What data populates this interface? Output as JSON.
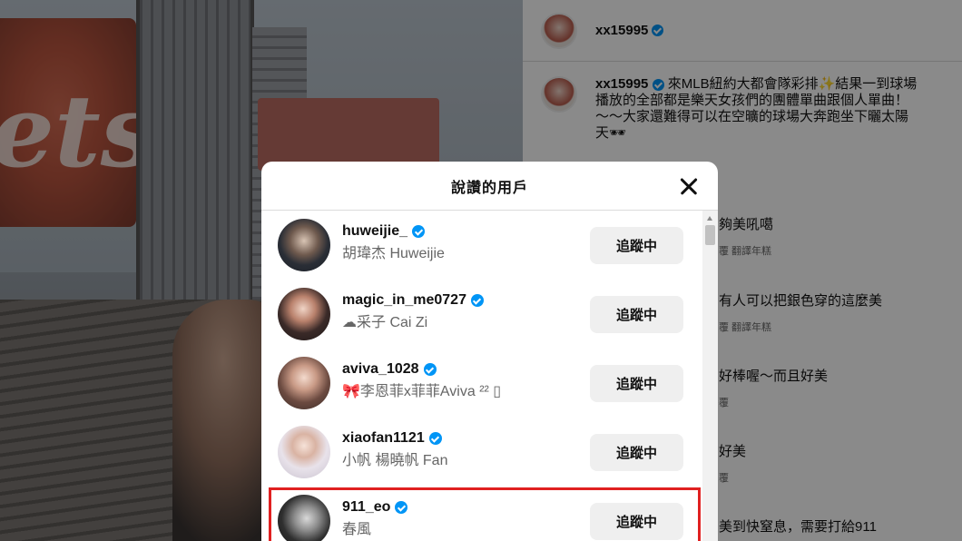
{
  "post": {
    "author": "xx15995",
    "caption_lines": [
      "來MLB紐約大都會隊彩排✨結果一到球場",
      "播放的全部都是樂天女孩們的團體單曲跟個人單曲！",
      "～～大家還難得可以在空曠的球場大奔跑坐下曬太陽",
      "天🕶"
    ]
  },
  "comments": [
    {
      "text": "夠美吼噶",
      "meta": "覆  翻譯年糕"
    },
    {
      "text": "有人可以把銀色穿的這麼美",
      "meta": "覆  翻譯年糕"
    },
    {
      "text": "好棒喔～而且好美",
      "meta": "覆"
    },
    {
      "text": "好美",
      "meta": "覆"
    },
    {
      "text": "美到快窒息，需要打給911",
      "meta": ""
    }
  ],
  "modal": {
    "title": "說讚的用戶",
    "users": [
      {
        "username": "huweijie_",
        "full_name": "胡瑋杰 Huweijie",
        "button": "追蹤中"
      },
      {
        "username": "magic_in_me0727",
        "full_name": "☁采子  Cai Zi",
        "button": "追蹤中"
      },
      {
        "username": "aviva_1028",
        "full_name": "🎀李恩菲x菲菲Aviva ²² ▯",
        "button": "追蹤中"
      },
      {
        "username": "xiaofan1121",
        "full_name": "小帆 楊曉帆 Fan",
        "button": "追蹤中"
      },
      {
        "username": "911_eo",
        "full_name": "春風",
        "button": "追蹤中"
      }
    ]
  },
  "colors": {
    "verified": "#0095f6",
    "highlight": "#e02020",
    "button_bg": "#efefef"
  },
  "icons": [
    "close-icon",
    "verified-badge-icon",
    "scroll-up-arrow-icon"
  ]
}
